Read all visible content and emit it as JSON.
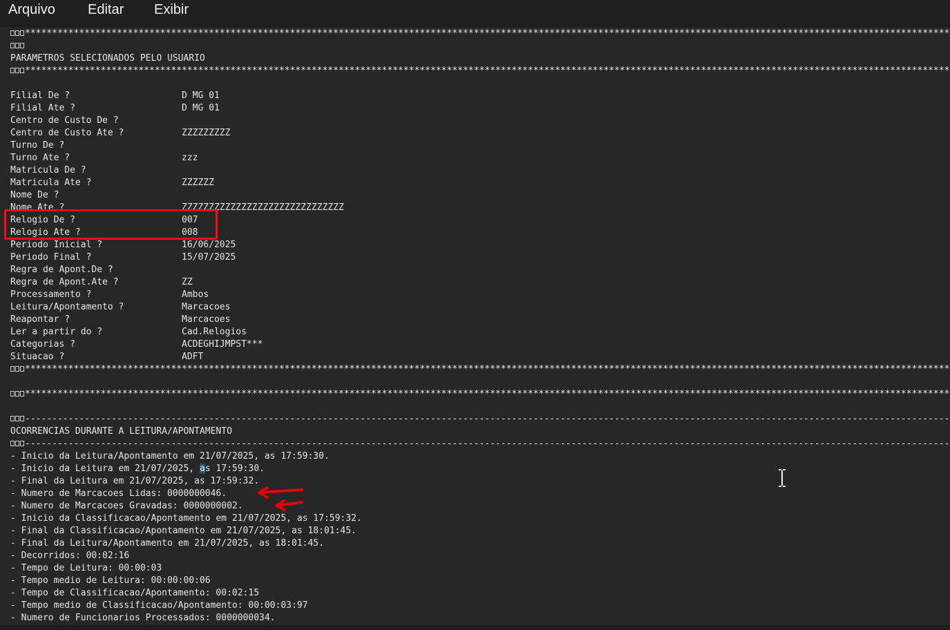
{
  "menu": {
    "items": [
      "Arquivo",
      "Editar",
      "Exibir"
    ]
  },
  "document": {
    "header_title": "PARAMETROS SELECIONADOS PELO USUARIO",
    "params": [
      {
        "label": "Filial De ?",
        "value": "D MG 01"
      },
      {
        "label": "Filial Ate ?",
        "value": "D MG 01"
      },
      {
        "label": "Centro de Custo De ?",
        "value": ""
      },
      {
        "label": "Centro de Custo Ate ?",
        "value": "ZZZZZZZZZ"
      },
      {
        "label": "Turno De ?",
        "value": ""
      },
      {
        "label": "Turno Ate ?",
        "value": "zzz"
      },
      {
        "label": "Matricula De ?",
        "value": ""
      },
      {
        "label": "Matricula Ate ?",
        "value": "ZZZZZZ"
      },
      {
        "label": "Nome De ?",
        "value": ""
      },
      {
        "label": "Nome Ate ?",
        "value": "ZZZZZZZZZZZZZZZZZZZZZZZZZZZZZZ"
      },
      {
        "label": "Relogio De ?",
        "value": "007"
      },
      {
        "label": "Relogio Ate ?",
        "value": "008"
      },
      {
        "label": "Periodo Inicial ?",
        "value": "16/06/2025"
      },
      {
        "label": "Periodo Final ?",
        "value": "15/07/2025"
      },
      {
        "label": "Regra de Apont.De ?",
        "value": ""
      },
      {
        "label": "Regra de Apont.Ate ?",
        "value": "ZZ"
      },
      {
        "label": "Processamento ?",
        "value": "Ambos"
      },
      {
        "label": "Leitura/Apontamento ?",
        "value": "Marcacoes"
      },
      {
        "label": "Reapontar ?",
        "value": "Marcacoes"
      },
      {
        "label": "Ler a partir do ?",
        "value": "Cad.Relogios"
      },
      {
        "label": "Categorias ?",
        "value": "ACDEGHIJMPST***"
      },
      {
        "label": "Situacao ?",
        "value": "ADFT"
      }
    ],
    "occurrences_title": "OCORRENCIAS DURANTE A LEITURA/APONTAMENTO",
    "occurrences": [
      "- Inicio da Leitura/Apontamento em 21/07/2025, as 17:59:30.",
      "- Inicio da Leitura em 21/07/2025, as 17:59:30.",
      "- Final da Leitura em 21/07/2025, as 17:59:32.",
      "- Numero de Marcacoes Lidas: 0000000046.",
      "- Numero de Marcacoes Gravadas: 0000000002.",
      "- Inicio da Classificacao/Apontamento em 21/07/2025, as 17:59:32.",
      "- Final da Classificacao/Apontamento em 21/07/2025, as 18:01:45.",
      "- Final da Leitura/Apontamento em 21/07/2025, as 18:01:45.",
      "- Decorridos: 00:02:16",
      "- Tempo de Leitura: 00:00:03",
      "- Tempo medio de Leitura: 00:00:00:06",
      "- Tempo de Classificacao/Apontamento: 00:02:15",
      "- Tempo medio de Classificacao/Apontamento: 00:00:03:97",
      "- Numero de Funcionarios Processados: 0000000034."
    ],
    "selected_line2_prefix": "- Inicio da Leitura em 21/07/2025, ",
    "selected_char": "a",
    "selected_line2_suffix": "s 17:59:30."
  },
  "colors": {
    "background": "#272727",
    "menubar": "#202020",
    "text": "#e6e6e6",
    "highlight_box": "#ff0a0a",
    "arrow": "#e00000",
    "selection": "#264f78"
  },
  "icons": {
    "text_cursor": "i-beam-cursor-icon",
    "control_char": "control-character-glyph"
  }
}
